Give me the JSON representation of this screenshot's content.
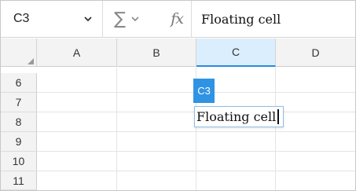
{
  "formula_bar": {
    "name_box": "C3",
    "sum_symbol": "∑",
    "fx_symbol": "fx",
    "formula": "Floating cell"
  },
  "columns": [
    "A",
    "B",
    "C",
    "D"
  ],
  "selected_column": "C",
  "rows": [
    "6",
    "7",
    "8",
    "9",
    "10",
    "11"
  ],
  "floating_cell": {
    "reference": "C3",
    "text": "Floating cell"
  },
  "icons": {
    "name_box_dropdown": "chevron-down-icon",
    "sum": "sigma-icon",
    "function": "fx-icon",
    "select_all": "select-all-corner-icon"
  },
  "colors": {
    "accent": "#2f93e4",
    "selected_header_bg": "#dbeefd",
    "header_bg": "#f3f3f3"
  }
}
